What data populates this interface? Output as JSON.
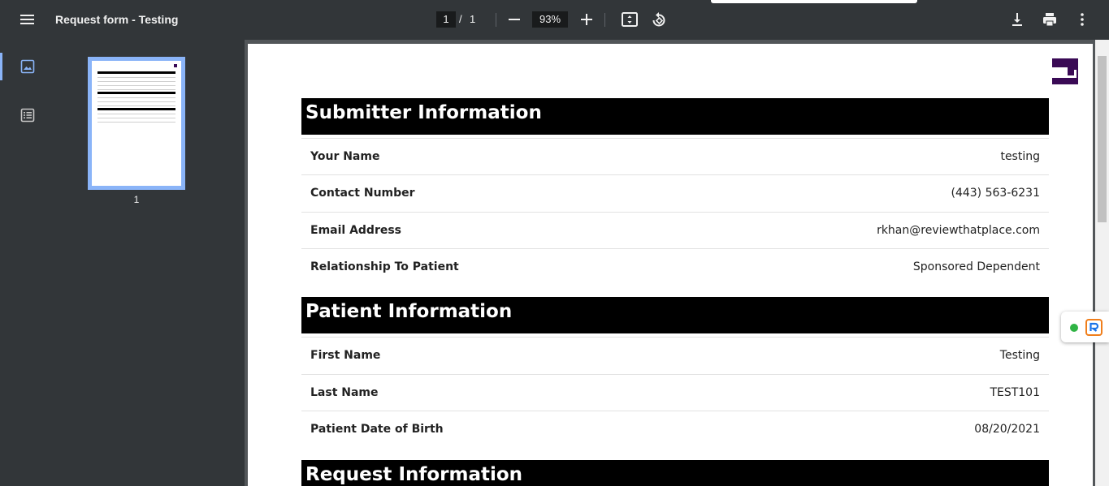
{
  "toolbar": {
    "title": "Request form - Testing",
    "page_current": "1",
    "page_separator": "/",
    "page_total": "1",
    "zoom": "93%",
    "icons": [
      "menu-icon",
      "zoom-out-icon",
      "zoom-in-icon",
      "fit-page-icon",
      "rotate-icon",
      "download-icon",
      "print-icon",
      "more-icon"
    ]
  },
  "sidebar": {
    "icons": [
      "thumbnails-icon",
      "outline-icon"
    ],
    "thumbnail_label": "1"
  },
  "document": {
    "sections": [
      {
        "title": "Submitter Information",
        "rows": [
          {
            "label": "Your Name",
            "value": "testing"
          },
          {
            "label": "Contact Number",
            "value": "(443) 563-6231"
          },
          {
            "label": "Email Address",
            "value": "rkhan@reviewthatplace.com"
          },
          {
            "label": "Relationship To Patient",
            "value": "Sponsored Dependent"
          }
        ]
      },
      {
        "title": "Patient Information",
        "rows": [
          {
            "label": "First Name",
            "value": "Testing"
          },
          {
            "label": "Last Name",
            "value": "TEST101"
          },
          {
            "label": "Patient Date of Birth",
            "value": "08/20/2021"
          }
        ]
      },
      {
        "title": "Request Information",
        "rows": []
      }
    ]
  },
  "colors": {
    "toolbar_bg": "#323639",
    "viewer_bg": "#525659",
    "accent": "#8ab4f8",
    "logo": "#3a0a55",
    "status_green": "#2fb344",
    "widget_orange": "#f07e1b"
  }
}
